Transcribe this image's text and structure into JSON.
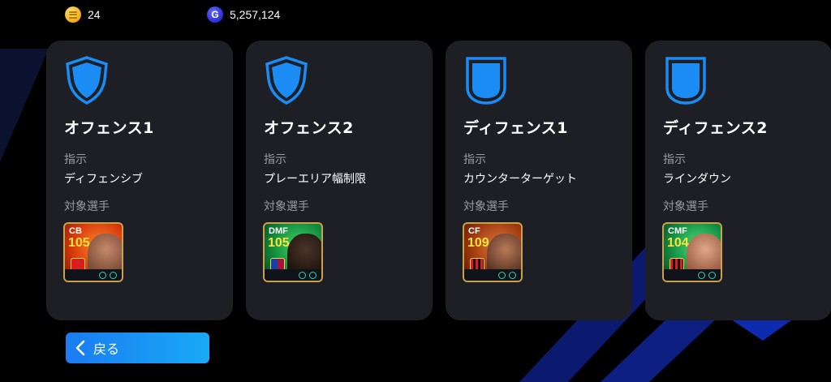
{
  "currency": {
    "coins": "24",
    "gp": "5,257,124",
    "gp_icon_letter": "G"
  },
  "cards": [
    {
      "title": "オフェンス1",
      "instruction_label": "指示",
      "instruction": "ディフェンシブ",
      "target_label": "対象選手",
      "shield_icon": "shield-pointed-icon",
      "player": {
        "position": "CB",
        "rating": "105",
        "club_icon": "manchester-united-crest-icon"
      }
    },
    {
      "title": "オフェンス2",
      "instruction_label": "指示",
      "instruction": "プレーエリア幅制限",
      "target_label": "対象選手",
      "shield_icon": "shield-pointed-icon",
      "player": {
        "position": "DMF",
        "rating": "105",
        "club_icon": "barcelona-crest-icon"
      }
    },
    {
      "title": "ディフェンス1",
      "instruction_label": "指示",
      "instruction": "カウンターターゲット",
      "target_label": "対象選手",
      "shield_icon": "shield-flat-icon",
      "player": {
        "position": "CF",
        "rating": "109",
        "club_icon": "ac-milan-crest-icon"
      }
    },
    {
      "title": "ディフェンス2",
      "instruction_label": "指示",
      "instruction": "ラインダウン",
      "target_label": "対象選手",
      "shield_icon": "shield-flat-icon",
      "player": {
        "position": "CMF",
        "rating": "104",
        "club_icon": "ac-milan-crest-icon"
      }
    }
  ],
  "back_button": {
    "label": "戻る"
  },
  "colors": {
    "accent_blue": "#1a8cf4",
    "card_bg": "#1d1f24",
    "rating_yellow": "#ffe23a",
    "card_border_gold": "#c9a14a"
  }
}
